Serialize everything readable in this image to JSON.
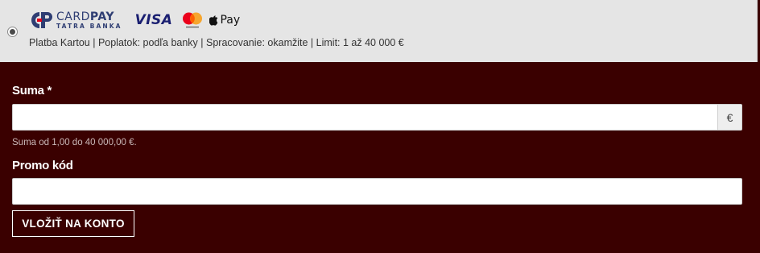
{
  "payment_method": {
    "selected": true,
    "logo_cardpay": {
      "word_light": "CARD",
      "word_bold": "PAY",
      "sub": "TATRA BANKA"
    },
    "logo_visa": "VISA",
    "logo_applepay": "Pay",
    "description": "Platba Kartou | Poplatok: podľa banky | Spracovanie: okamžite | Limit: 1 až 40 000 €",
    "colors": {
      "cardpay_blue": "#2f3e73",
      "cardpay_red": "#e2001a",
      "visa_blue": "#1a1f71",
      "mc_red": "#eb001b",
      "mc_orange": "#f79e1b"
    }
  },
  "form": {
    "amount_label": "Suma *",
    "amount_value": "",
    "currency": "€",
    "amount_hint": "Suma od 1,00 do 40 000,00 €.",
    "promo_label": "Promo kód",
    "promo_value": "",
    "submit_label": "VLOŽIŤ NA KONTO"
  },
  "colors": {
    "background": "#3a0000",
    "method_row_bg": "#e5e5e5",
    "text_light": "#ffffff"
  }
}
